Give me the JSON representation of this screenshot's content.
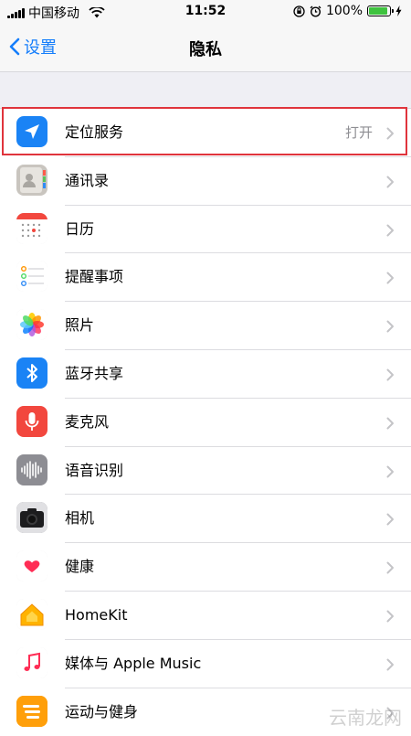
{
  "status_bar": {
    "carrier": "中国移动",
    "time": "11:52",
    "battery": "100%",
    "battery_level": 1.0
  },
  "nav": {
    "back_label": "设置",
    "title": "隐私"
  },
  "rows": [
    {
      "label": "定位服务",
      "value": "打开",
      "icon": "location-arrow-icon",
      "color": "#1a83f5"
    },
    {
      "label": "通讯录",
      "value": "",
      "icon": "contacts-icon",
      "color": "#c9c5bf"
    },
    {
      "label": "日历",
      "value": "",
      "icon": "calendar-icon",
      "color": "#ffffff"
    },
    {
      "label": "提醒事项",
      "value": "",
      "icon": "reminders-icon",
      "color": "#ffffff"
    },
    {
      "label": "照片",
      "value": "",
      "icon": "photos-icon",
      "color": "#ffffff"
    },
    {
      "label": "蓝牙共享",
      "value": "",
      "icon": "bluetooth-icon",
      "color": "#1a83f5"
    },
    {
      "label": "麦克风",
      "value": "",
      "icon": "microphone-icon",
      "color": "#f2473e"
    },
    {
      "label": "语音识别",
      "value": "",
      "icon": "waveform-icon",
      "color": "#8d8d93"
    },
    {
      "label": "相机",
      "value": "",
      "icon": "camera-icon",
      "color": "#8d8d93"
    },
    {
      "label": "健康",
      "value": "",
      "icon": "heart-icon",
      "color": "#ffffff"
    },
    {
      "label": "HomeKit",
      "value": "",
      "icon": "home-icon",
      "color": "#ffffff"
    },
    {
      "label": "媒体与 Apple Music",
      "value": "",
      "icon": "music-note-icon",
      "color": "#ffffff"
    },
    {
      "label": "运动与健身",
      "value": "",
      "icon": "motion-icon",
      "color": "#ff9f0a"
    }
  ],
  "watermark": "云南龙网"
}
